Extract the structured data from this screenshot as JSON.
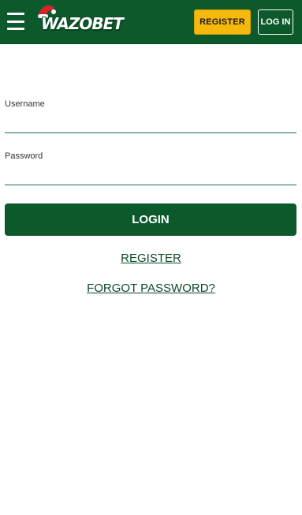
{
  "header": {
    "brand": "WAZOBET",
    "register_label": "REGISTER",
    "login_label": "LOG IN",
    "icons": {
      "menu": "hamburger-menu-icon",
      "logo_hat": "santa-hat-icon"
    },
    "colors": {
      "bar": "#0c5a2c",
      "register_bg": "#f5b80c"
    }
  },
  "form": {
    "username_label": "Username",
    "username_value": "",
    "password_label": "Password",
    "password_value": "",
    "submit_label": "LOGIN"
  },
  "links": {
    "register": "REGISTER",
    "forgot_password": "FORGOT PASSWORD?"
  }
}
